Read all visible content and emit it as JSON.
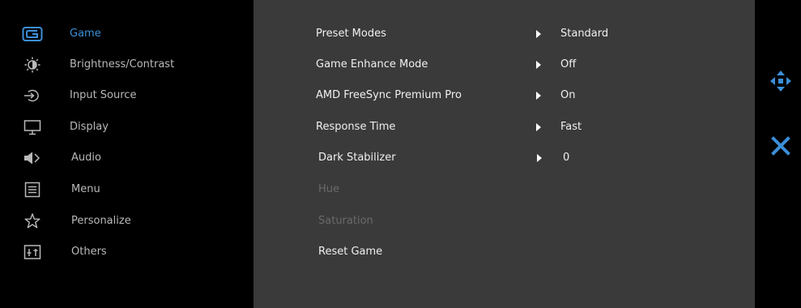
{
  "sidebar": {
    "accent_color": "#3b8fd8",
    "items": [
      {
        "label": "Game",
        "icon": "game-icon",
        "active": true
      },
      {
        "label": "Brightness/Contrast",
        "icon": "brightness-icon",
        "active": false
      },
      {
        "label": "Input Source",
        "icon": "input-source-icon",
        "active": false
      },
      {
        "label": "Display",
        "icon": "display-icon",
        "active": false
      },
      {
        "label": "Audio",
        "icon": "audio-icon",
        "active": false
      },
      {
        "label": "Menu",
        "icon": "menu-icon",
        "active": false
      },
      {
        "label": "Personalize",
        "icon": "star-icon",
        "active": false
      },
      {
        "label": "Others",
        "icon": "others-icon",
        "active": false
      }
    ]
  },
  "game_menu": {
    "rows": [
      {
        "label": "Preset Modes",
        "value": "Standard"
      },
      {
        "label": "Game Enhance Mode",
        "value": "Off"
      },
      {
        "label": "AMD FreeSync Premium Pro",
        "value": "On"
      },
      {
        "label": "Response Time",
        "value": "Fast"
      },
      {
        "label": "Dark Stabilizer",
        "value": "0"
      },
      {
        "label": "Hue",
        "disabled": true
      },
      {
        "label": "Saturation",
        "disabled": true
      },
      {
        "label": "Reset Game"
      }
    ]
  },
  "controls": {
    "navigate_icon": "four-way-arrow-icon",
    "exit_icon": "close-icon",
    "icon_color": "#3b8fd8"
  }
}
